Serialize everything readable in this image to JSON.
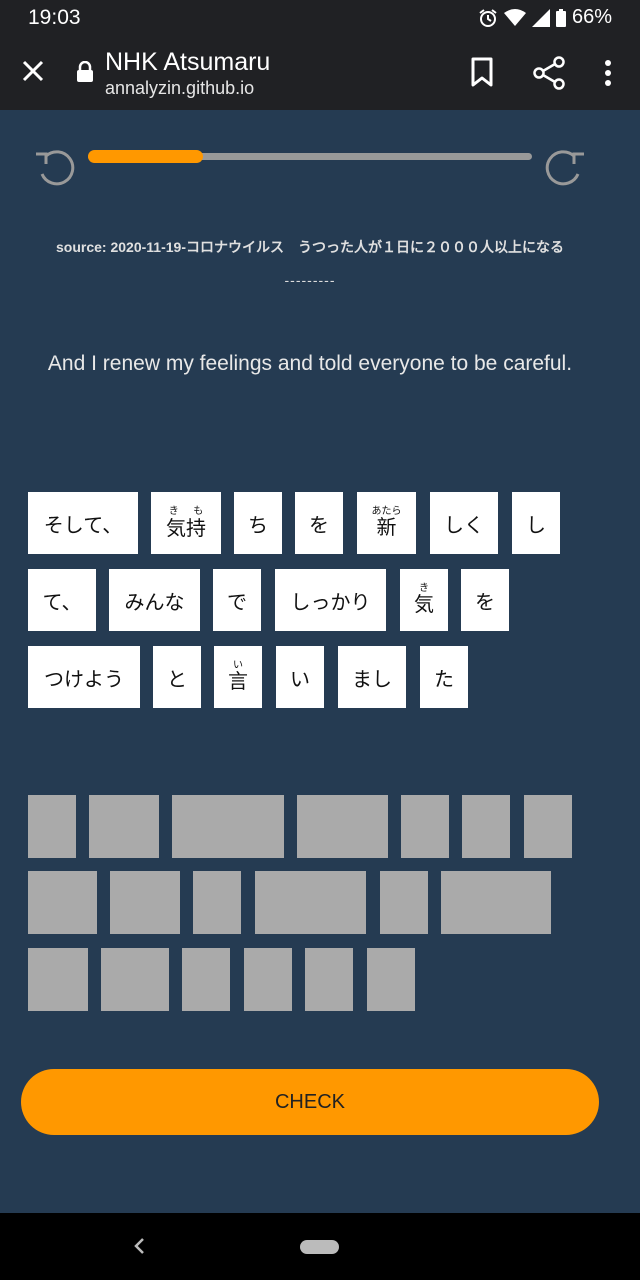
{
  "status": {
    "time": "19:03",
    "battery": "66%"
  },
  "browser": {
    "title": "NHK Atsumaru",
    "url": "annalyzin.github.io"
  },
  "progress": 0.26,
  "source": "source: 2020-11-19-コロナウイルス　うつった人が１日に２０００人以上になる",
  "placeholder": "---------",
  "sentence": "And I renew my feelings and told everyone to be careful.",
  "tiles": [
    {
      "text": "そして、",
      "ruby": ""
    },
    {
      "text": "気持",
      "ruby": "き も"
    },
    {
      "text": "ち",
      "ruby": ""
    },
    {
      "text": "を",
      "ruby": ""
    },
    {
      "text": "新",
      "ruby": "あたら"
    },
    {
      "text": "しく",
      "ruby": ""
    },
    {
      "text": "し",
      "ruby": ""
    },
    {
      "text": "て、",
      "ruby": ""
    },
    {
      "text": "みんな",
      "ruby": ""
    },
    {
      "text": "で",
      "ruby": ""
    },
    {
      "text": "しっかり",
      "ruby": ""
    },
    {
      "text": "気",
      "ruby": "き"
    },
    {
      "text": "を",
      "ruby": ""
    },
    {
      "text": "つけよう",
      "ruby": ""
    },
    {
      "text": "と",
      "ruby": ""
    },
    {
      "text": "言",
      "ruby": "い"
    },
    {
      "text": "い",
      "ruby": ""
    },
    {
      "text": "まし",
      "ruby": ""
    },
    {
      "text": "た",
      "ruby": ""
    }
  ],
  "check_label": "CHECK"
}
